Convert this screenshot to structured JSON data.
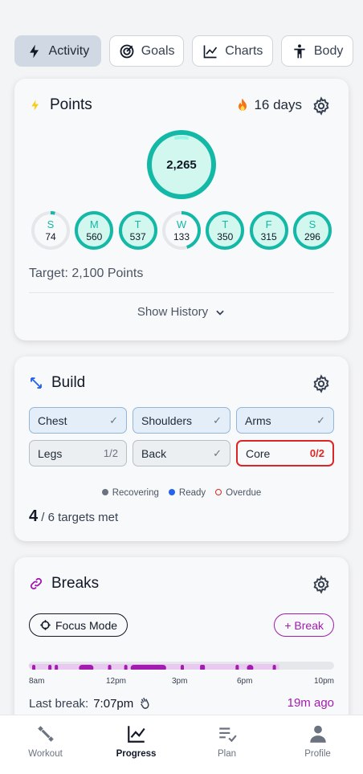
{
  "tabs": [
    {
      "label": "Activity",
      "icon": "bolt-icon",
      "active": true
    },
    {
      "label": "Goals",
      "icon": "target-icon"
    },
    {
      "label": "Charts",
      "icon": "line-chart-icon"
    },
    {
      "label": "Body",
      "icon": "person-icon"
    }
  ],
  "points": {
    "title": "Points",
    "streak": "16 days",
    "total": "2,265",
    "total_progress": 1.0,
    "days": [
      {
        "label": "S",
        "value": "74",
        "progress": 0.04
      },
      {
        "label": "M",
        "value": "560",
        "progress": 1.0
      },
      {
        "label": "T",
        "value": "537",
        "progress": 1.0
      },
      {
        "label": "W",
        "value": "133",
        "progress": 0.45
      },
      {
        "label": "T",
        "value": "350",
        "progress": 1.0
      },
      {
        "label": "F",
        "value": "315",
        "progress": 1.0
      },
      {
        "label": "S",
        "value": "296",
        "progress": 1.0
      }
    ],
    "target": "Target: 2,100 Points",
    "history_label": "Show History"
  },
  "build": {
    "title": "Build",
    "chips": [
      {
        "label": "Chest",
        "status": "ready",
        "mark": "✓"
      },
      {
        "label": "Shoulders",
        "status": "ready",
        "mark": "✓"
      },
      {
        "label": "Arms",
        "status": "ready",
        "mark": "✓"
      },
      {
        "label": "Legs",
        "status": "recovering",
        "mark": "1/2"
      },
      {
        "label": "Back",
        "status": "recovering",
        "mark": "✓"
      },
      {
        "label": "Core",
        "status": "overdue",
        "mark": "0/2"
      }
    ],
    "legend": {
      "recovering": "Recovering",
      "ready": "Ready",
      "overdue": "Overdue"
    },
    "met_count": "4",
    "met_rest": "/ 6 targets met"
  },
  "breaks": {
    "title": "Breaks",
    "focus_label": "Focus Mode",
    "add_label": "+ Break",
    "timeline_labels": [
      "8am",
      "12pm",
      "3pm",
      "6pm",
      "10pm"
    ],
    "last_label": "Last break:",
    "last_time": "7:07pm",
    "ago": "19m ago"
  },
  "nav": [
    {
      "label": "Workout"
    },
    {
      "label": "Progress",
      "active": true
    },
    {
      "label": "Plan"
    },
    {
      "label": "Profile"
    }
  ],
  "colors": {
    "teal": "#14b8a6",
    "purple": "#a21caf",
    "blue": "#2563eb",
    "red": "#dc2626"
  }
}
